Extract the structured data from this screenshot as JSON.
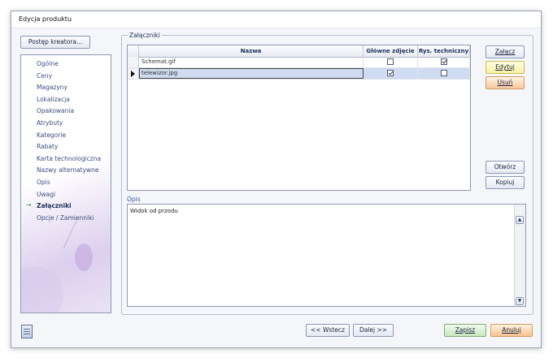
{
  "window": {
    "title": "Edycja produktu"
  },
  "wizard": {
    "progress_label": "Postęp kreatora...",
    "steps": [
      "Ogólne",
      "Ceny",
      "Magazyny",
      "Lokalizacja",
      "Opakowania",
      "Atrybuty",
      "Kategorie",
      "Rabaty",
      "Karta technologiczna",
      "Nazwy alternatywne",
      "Opis",
      "Uwagi",
      "Załączniki",
      "Opcje / Zamienniki"
    ],
    "active_step": "Załączniki",
    "active_marker": "→"
  },
  "attachments": {
    "group_label": "Załączniki",
    "columns": [
      "Nazwa",
      "Główne zdjęcie",
      "Rys. techniczny"
    ],
    "rows": [
      {
        "name": "Schemat.gif",
        "main_photo": false,
        "tech_drawing": true,
        "selected": false
      },
      {
        "name": "telewizor.jpg",
        "main_photo": true,
        "tech_drawing": false,
        "selected": true
      }
    ],
    "buttons": {
      "attach": "Załącz",
      "edit": "Edytuj",
      "delete": "Usuń",
      "open": "Otwórz",
      "copy": "Kopiuj"
    }
  },
  "description": {
    "label": "Opis",
    "value": "Widok od przodu"
  },
  "footer": {
    "back": "<< Wstecz",
    "next": "Dalej >>",
    "save": "Zapisz",
    "cancel": "Anuluj"
  },
  "icons": {
    "row_pointer": "arrow-right-filled",
    "scroll_up": "chevron-up",
    "scroll_down": "chevron-down",
    "notes": "notes-document"
  }
}
